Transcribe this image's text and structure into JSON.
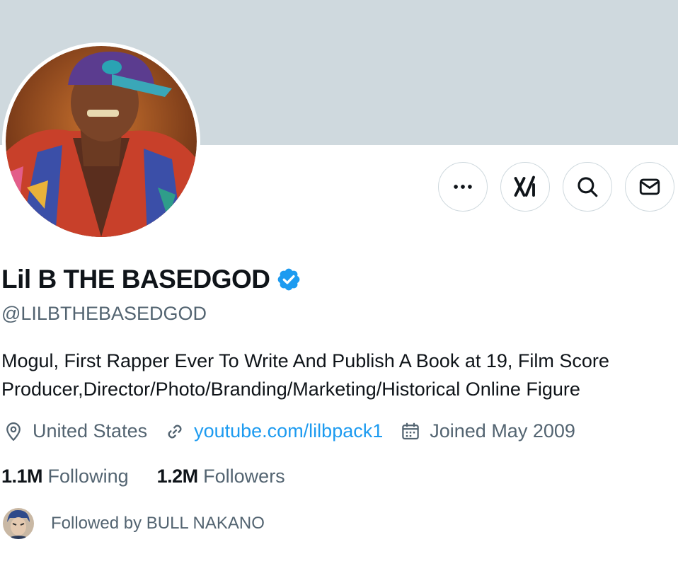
{
  "profile": {
    "display_name": "Lil B THE BASEDGOD",
    "verified_icon": "verified-badge-icon",
    "handle": "@LILBTHEBASEDGOD",
    "bio_lines": [
      "Mogul, First Rapper Ever To Write And Publish A Book at 19, Film Score",
      "Producer,Director/Photo/Branding/Marketing/Historical Online Figure"
    ],
    "location": "United States",
    "website": "youtube.com/lilbpack1",
    "joined": "Joined May 2009"
  },
  "stats": {
    "following_count": "1.1M",
    "following_label": "Following",
    "followers_count": "1.2M",
    "followers_label": "Followers"
  },
  "followed_by": {
    "text": "Followed by BULL NAKANO"
  },
  "actions": [
    {
      "name": "more-options-button",
      "icon": "ellipsis-icon"
    },
    {
      "name": "grok-button",
      "icon": "grok-icon"
    },
    {
      "name": "search-button",
      "icon": "search-icon"
    },
    {
      "name": "message-button",
      "icon": "envelope-icon"
    }
  ],
  "colors": {
    "banner": "#cfd9de",
    "text_primary": "#0f1419",
    "text_secondary": "#536471",
    "link": "#1d9bf0",
    "verified": "#1d9bf0"
  }
}
